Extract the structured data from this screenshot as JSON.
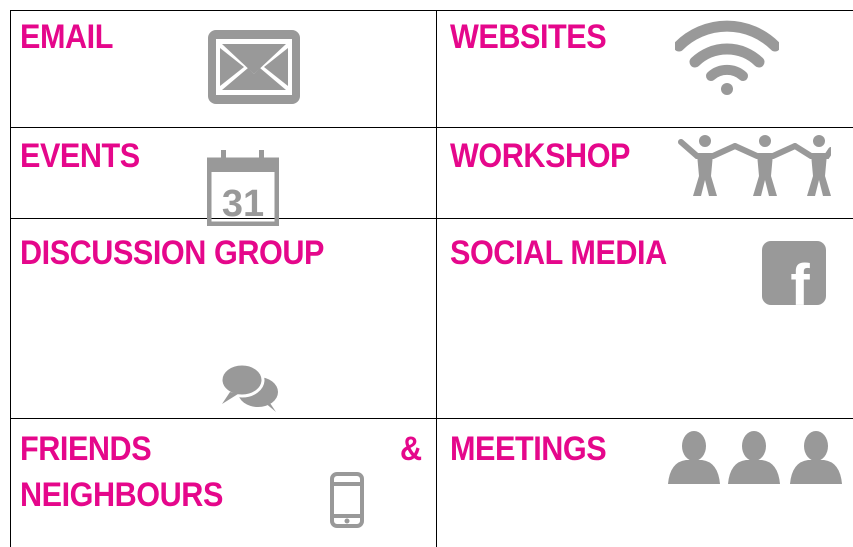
{
  "cells": {
    "email": {
      "label": "EMAIL",
      "icon": "envelope-icon"
    },
    "websites": {
      "label": "WEBSITES",
      "icon": "wifi-icon"
    },
    "events": {
      "label": "EVENTS",
      "icon": "calendar-icon",
      "calendar_day": "31"
    },
    "workshop": {
      "label": "WORKSHOP",
      "icon": "people-holding-hands-icon"
    },
    "discussion": {
      "label": "DISCUSSION GROUP",
      "icon": "speech-bubbles-icon"
    },
    "social": {
      "label": "SOCIAL MEDIA",
      "icon": "facebook-icon",
      "glyph": "f"
    },
    "friends": {
      "label_line1": "FRIENDS",
      "label_amp": "&",
      "label_line2": "NEIGHBOURS",
      "icon": "mobile-phone-icon"
    },
    "meetings": {
      "label": "MEETINGS",
      "icon": "users-icon"
    }
  },
  "colors": {
    "accent": "#e5078b",
    "icon_gray": "#999999",
    "grid": "#000000"
  }
}
